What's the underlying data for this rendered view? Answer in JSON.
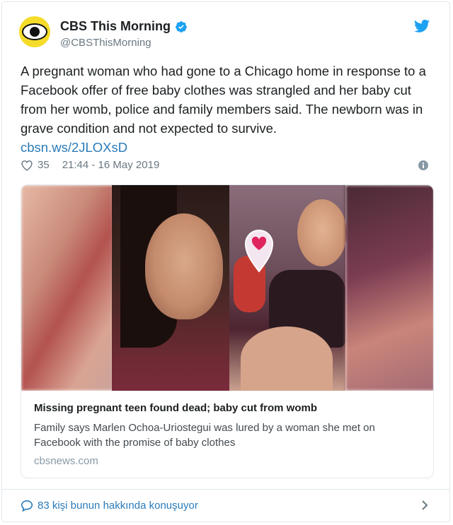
{
  "author": {
    "display_name": "CBS This Morning",
    "handle": "@CBSThisMorning",
    "avatar_icon": "cbs-eye-logo",
    "verified_icon": "verified-badge-icon"
  },
  "tweet": {
    "text": "A pregnant woman who had gone to a Chicago home in response to a Facebook offer of free baby clothes was strangled and her baby cut from her womb, police and family members said. The newborn was in grave condition and not expected to survive.",
    "link": "cbsn.ws/2JLOXsD",
    "likes": "35",
    "timestamp": "21:44 - 16 May 2019"
  },
  "preview": {
    "title": "Missing pregnant teen found dead; baby cut from womb",
    "description": "Family says Marlen Ochoa-Uriostegui was lured by a woman she met on Facebook with the promise of baby clothes",
    "domain": "cbsnews.com"
  },
  "footer": {
    "conversation_text": "83 kişi bunun hakkında konuşuyor"
  },
  "colors": {
    "link": "#2b7bb9",
    "twitter_blue": "#1da1f2",
    "heart_red": "#e0245e"
  }
}
